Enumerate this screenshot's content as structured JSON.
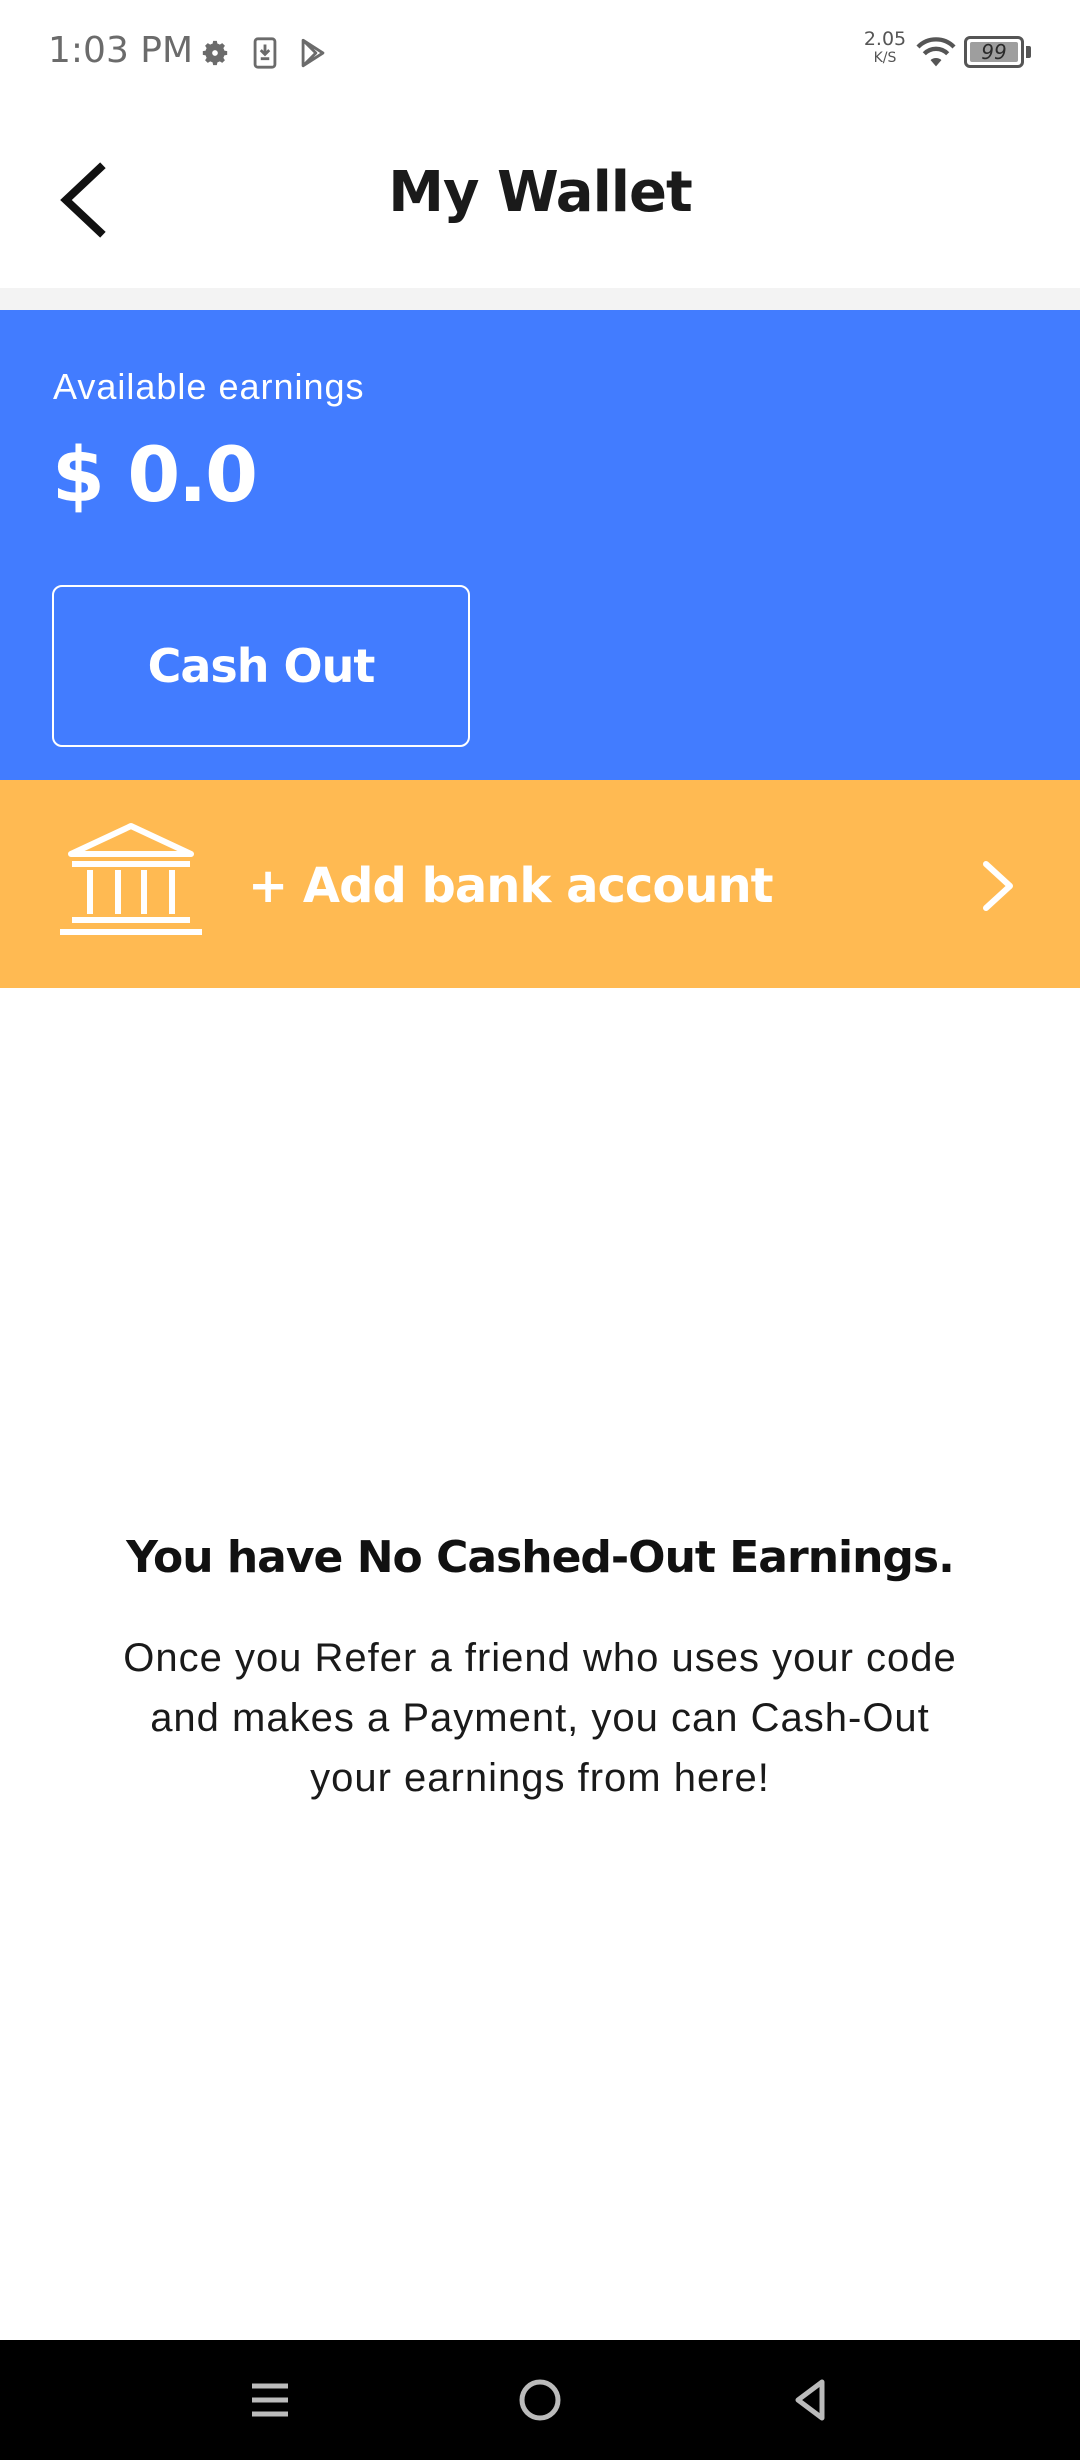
{
  "status_bar": {
    "time": "1:03 PM",
    "icons": [
      "gear-icon",
      "download-icon",
      "play-store-icon"
    ],
    "net_speed_value": "2.05",
    "net_speed_unit": "K/S",
    "battery": "99"
  },
  "header": {
    "title": "My Wallet",
    "back_icon": "chevron-left-icon"
  },
  "earnings": {
    "label": "Available earnings",
    "amount": "$ 0.0",
    "cash_out_label": "Cash Out"
  },
  "bank": {
    "label": "+ Add bank account",
    "icon": "bank-icon",
    "chevron": "chevron-right-icon"
  },
  "empty_state": {
    "title": "You have No Cashed-Out Earnings.",
    "description": "Once you Refer a friend who uses your code and makes a Payment, you can Cash-Out your earnings from here!"
  },
  "nav": {
    "icons": [
      "menu-icon",
      "home-icon",
      "back-icon"
    ]
  },
  "colors": {
    "earnings_bg": "#427cff",
    "bank_bg": "#ffba52"
  }
}
